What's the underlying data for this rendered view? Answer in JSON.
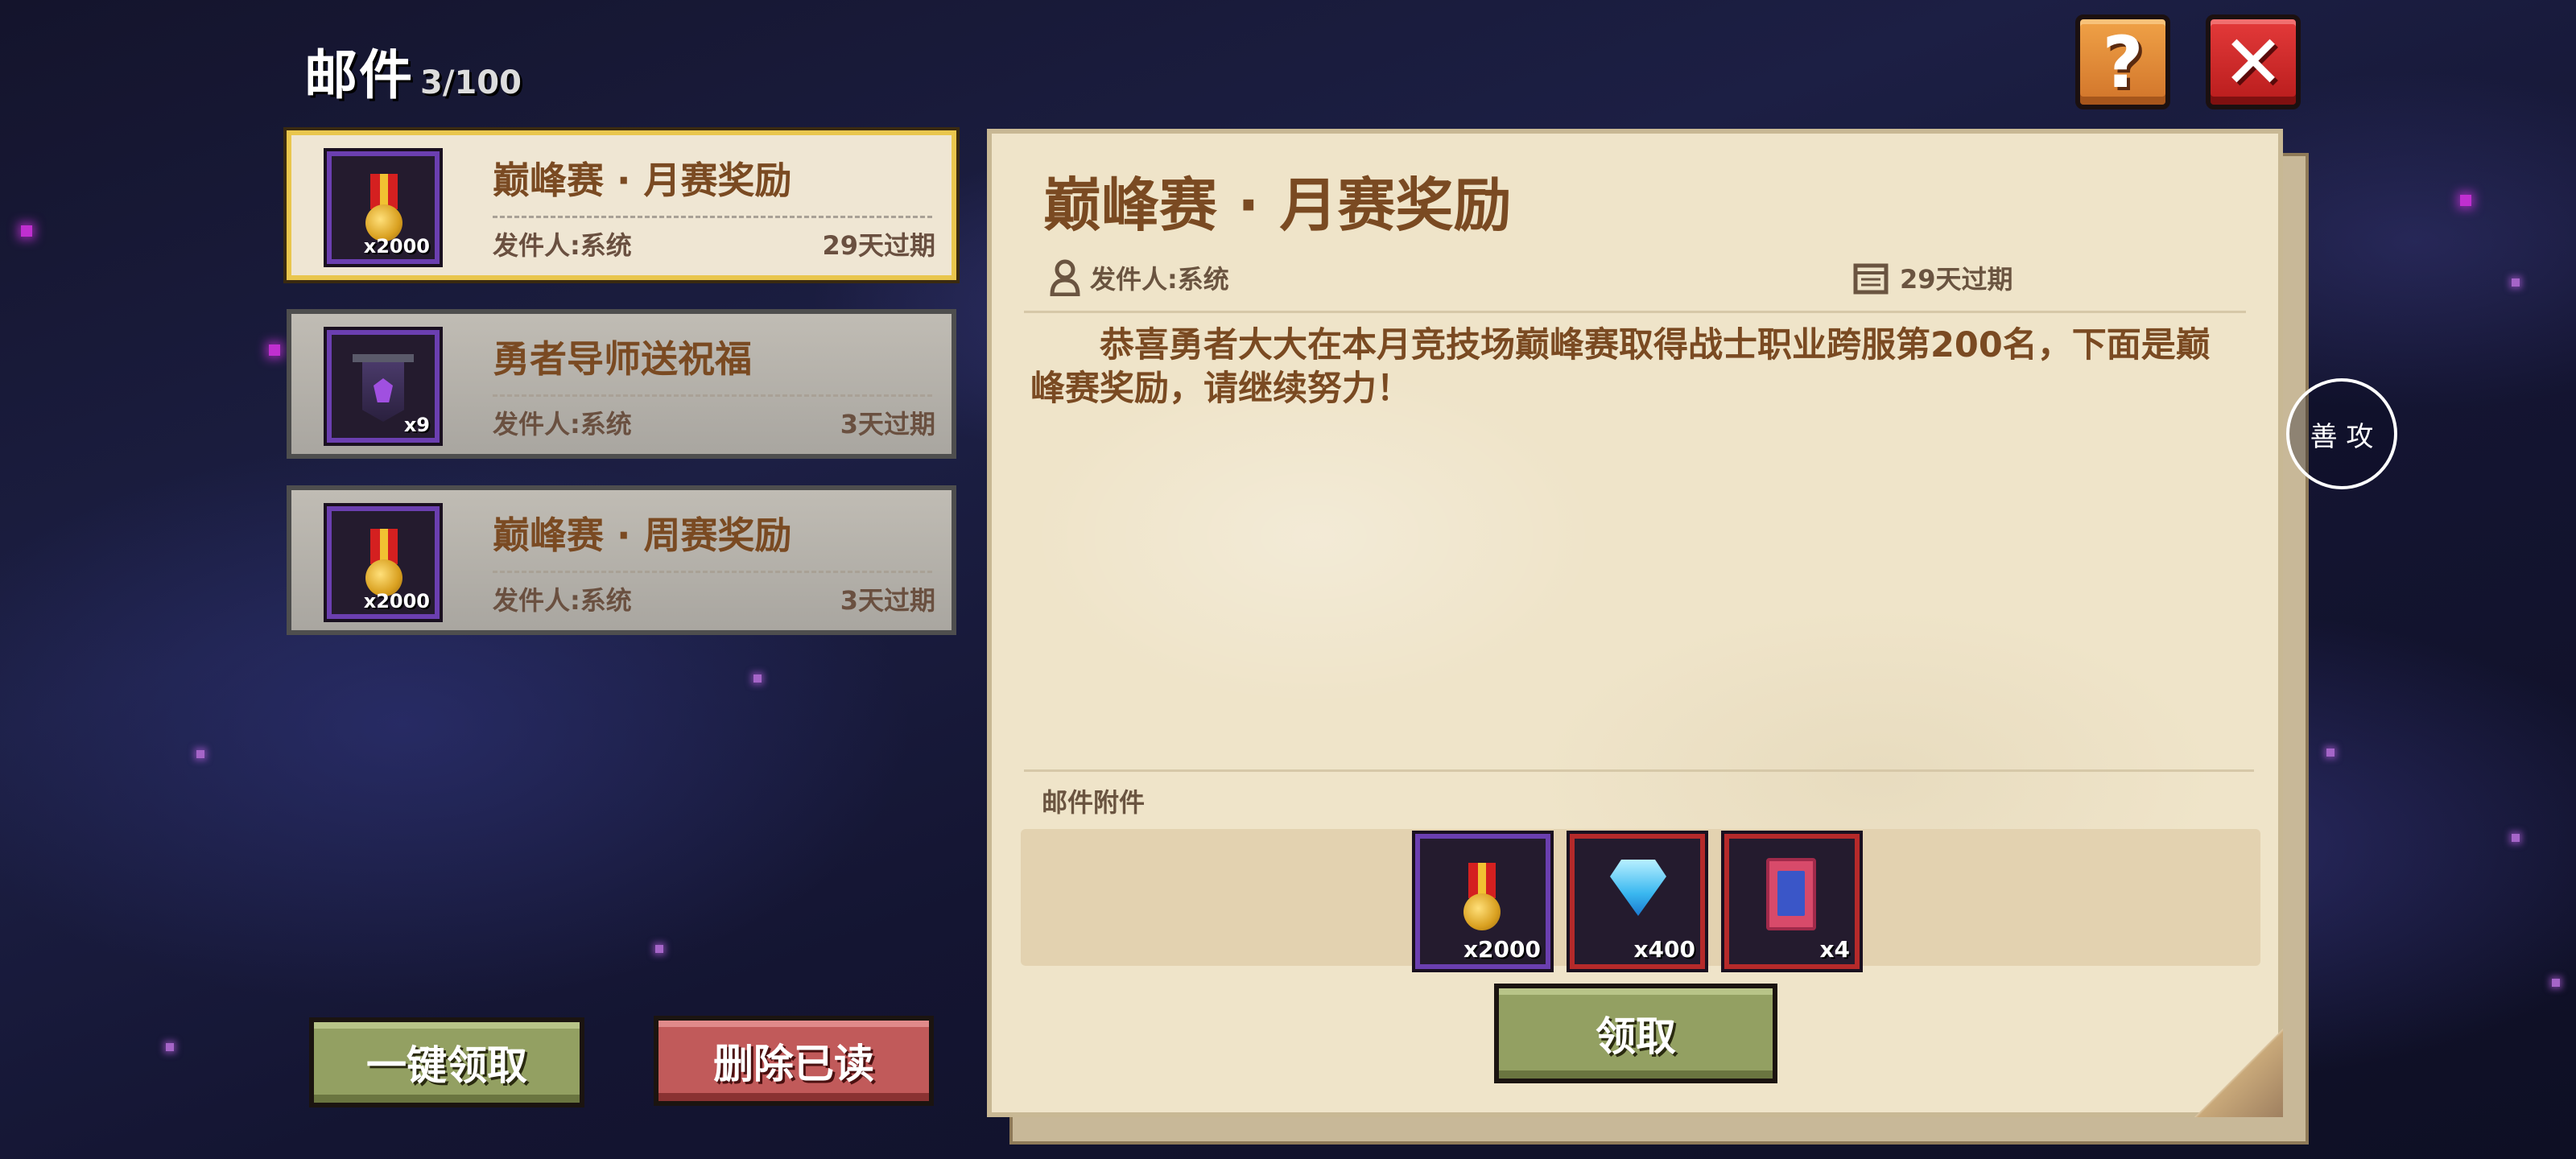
{
  "header": {
    "title": "邮件",
    "count": "3/100",
    "help_icon": "question-mark-icon",
    "close_icon": "close-x-icon"
  },
  "mail_list": [
    {
      "title": "巅峰赛 · 月赛奖励",
      "sender": "发件人:系统",
      "expire": "29天过期",
      "icon": "medal-icon",
      "qty": "x2000",
      "selected": true
    },
    {
      "title": "勇者导师送祝福",
      "sender": "发件人:系统",
      "expire": "3天过期",
      "icon": "banner-icon",
      "qty": "x9",
      "selected": false
    },
    {
      "title": "巅峰赛 · 周赛奖励",
      "sender": "发件人:系统",
      "expire": "3天过期",
      "icon": "medal-icon",
      "qty": "x2000",
      "selected": false
    }
  ],
  "actions": {
    "claim_all": "一键领取",
    "delete_read": "删除已读"
  },
  "detail": {
    "title": "巅峰赛 · 月赛奖励",
    "sender": "发件人:系统",
    "expire": "29天过期",
    "body": "恭喜勇者大大在本月竞技场巅峰赛取得战士职业跨服第200名，下面是巅峰赛奖励，请继续努力！",
    "attachments_label": "邮件附件",
    "attachments": [
      {
        "icon": "medal-icon",
        "qty": "x2000"
      },
      {
        "icon": "diamond-icon",
        "qty": "x400"
      },
      {
        "icon": "card-icon",
        "qty": "x4"
      }
    ],
    "claim_button": "领取"
  },
  "side_button": "善 攻",
  "colors": {
    "accent_brown": "#7a4a22",
    "selected_border": "#e9c64d",
    "green_button": "#93a062",
    "red_button": "#c15a5a",
    "help_orange": "#e58a38",
    "close_red": "#d42a2a"
  }
}
